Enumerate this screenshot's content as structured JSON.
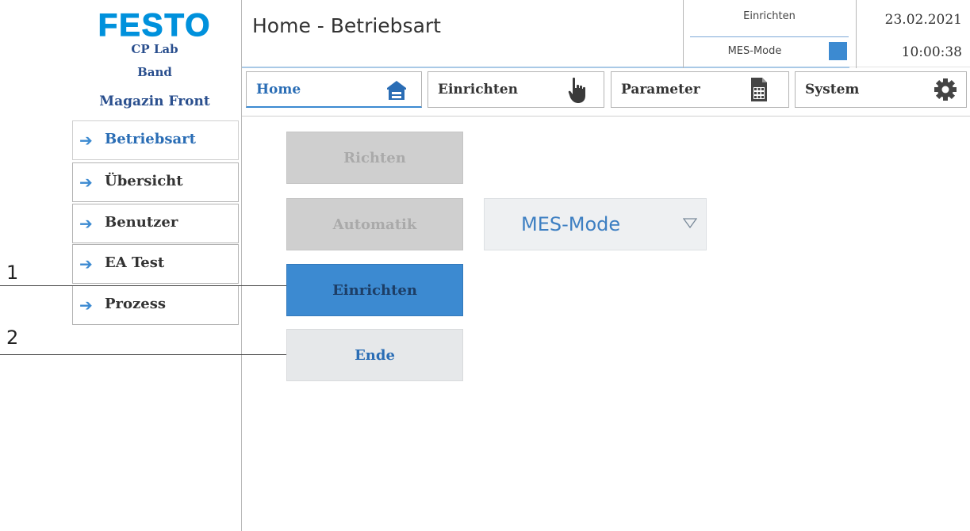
{
  "brand": {
    "logo_text": "FESTO",
    "logo_color": "#0091dc",
    "station_line1": "CP Lab",
    "station_line2": "Band",
    "station_line3": "Magazin Front"
  },
  "header": {
    "title": "Home - Betriebsart",
    "status_mode": "Einrichten",
    "status_mes_label": "MES-Mode",
    "status_mes_indicator_color": "#3c8ad1",
    "date": "23.02.2021",
    "time": "10:00:38"
  },
  "tabs": [
    {
      "label": "Home",
      "icon": "home-building-icon",
      "active": true
    },
    {
      "label": "Einrichten",
      "icon": "hand-pointer-icon",
      "active": false
    },
    {
      "label": "Parameter",
      "icon": "document-table-icon",
      "active": false
    },
    {
      "label": "System",
      "icon": "gear-icon",
      "active": false
    }
  ],
  "sidebar": {
    "items": [
      {
        "label": "Betriebsart",
        "icon": "arrow-right-icon",
        "active": true
      },
      {
        "label": "Übersicht",
        "icon": "arrow-right-icon",
        "active": false
      },
      {
        "label": "Benutzer",
        "icon": "arrow-right-icon",
        "active": false
      },
      {
        "label": "EA Test",
        "icon": "arrow-right-icon",
        "active": false
      },
      {
        "label": "Prozess",
        "icon": "arrow-right-icon",
        "active": false
      }
    ]
  },
  "main": {
    "buttons": {
      "richten": "Richten",
      "automatik": "Automatik",
      "einrichten": "Einrichten",
      "ende": "Ende"
    },
    "mode_dropdown": {
      "selected": "MES-Mode",
      "icon": "triangle-down-icon"
    }
  },
  "callouts": {
    "one": "1",
    "two": "2"
  },
  "colors": {
    "accent": "#3c8ad1",
    "disabled_button": "#cfcfcf",
    "label_blue": "#2a6db5"
  }
}
